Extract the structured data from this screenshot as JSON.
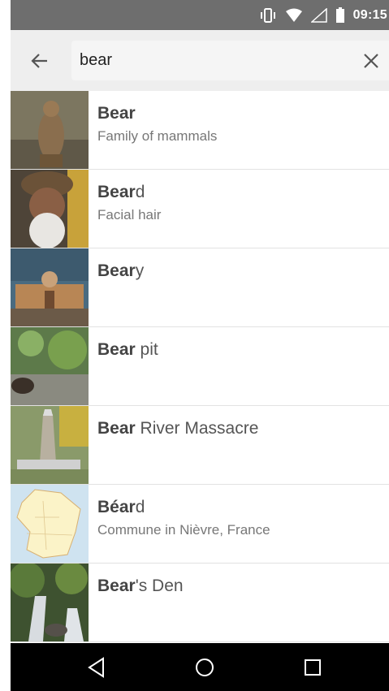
{
  "status_bar": {
    "time": "09:15",
    "icons": [
      "vibrate-icon",
      "wifi-icon",
      "cell-signal-icon",
      "battery-icon"
    ]
  },
  "search": {
    "back_icon": "arrow-left-icon",
    "query": "bear",
    "clear_icon": "close-icon"
  },
  "results": [
    {
      "bold": "Bear",
      "rest": "",
      "description": "Family of mammals",
      "thumb": "bear-photo"
    },
    {
      "bold": "Bear",
      "rest": "d",
      "description": "Facial hair",
      "thumb": "bearded-man-photo"
    },
    {
      "bold": "Bear",
      "rest": "y",
      "description": "",
      "thumb": "palace-photo"
    },
    {
      "bold": "Bear",
      "rest": " pit",
      "description": "",
      "thumb": "bear-pit-photo"
    },
    {
      "bold": "Bear",
      "rest": " River Massacre",
      "description": "",
      "thumb": "monument-photo"
    },
    {
      "bold": "Béar",
      "rest": "d",
      "description": "Commune in Nièvre, France",
      "thumb": "france-map"
    },
    {
      "bold": "Bear",
      "rest": "'s Den",
      "description": "",
      "thumb": "waterfall-photo"
    }
  ],
  "nav_bar": {
    "icons": [
      "back-triangle-icon",
      "home-circle-icon",
      "recents-square-icon"
    ]
  }
}
